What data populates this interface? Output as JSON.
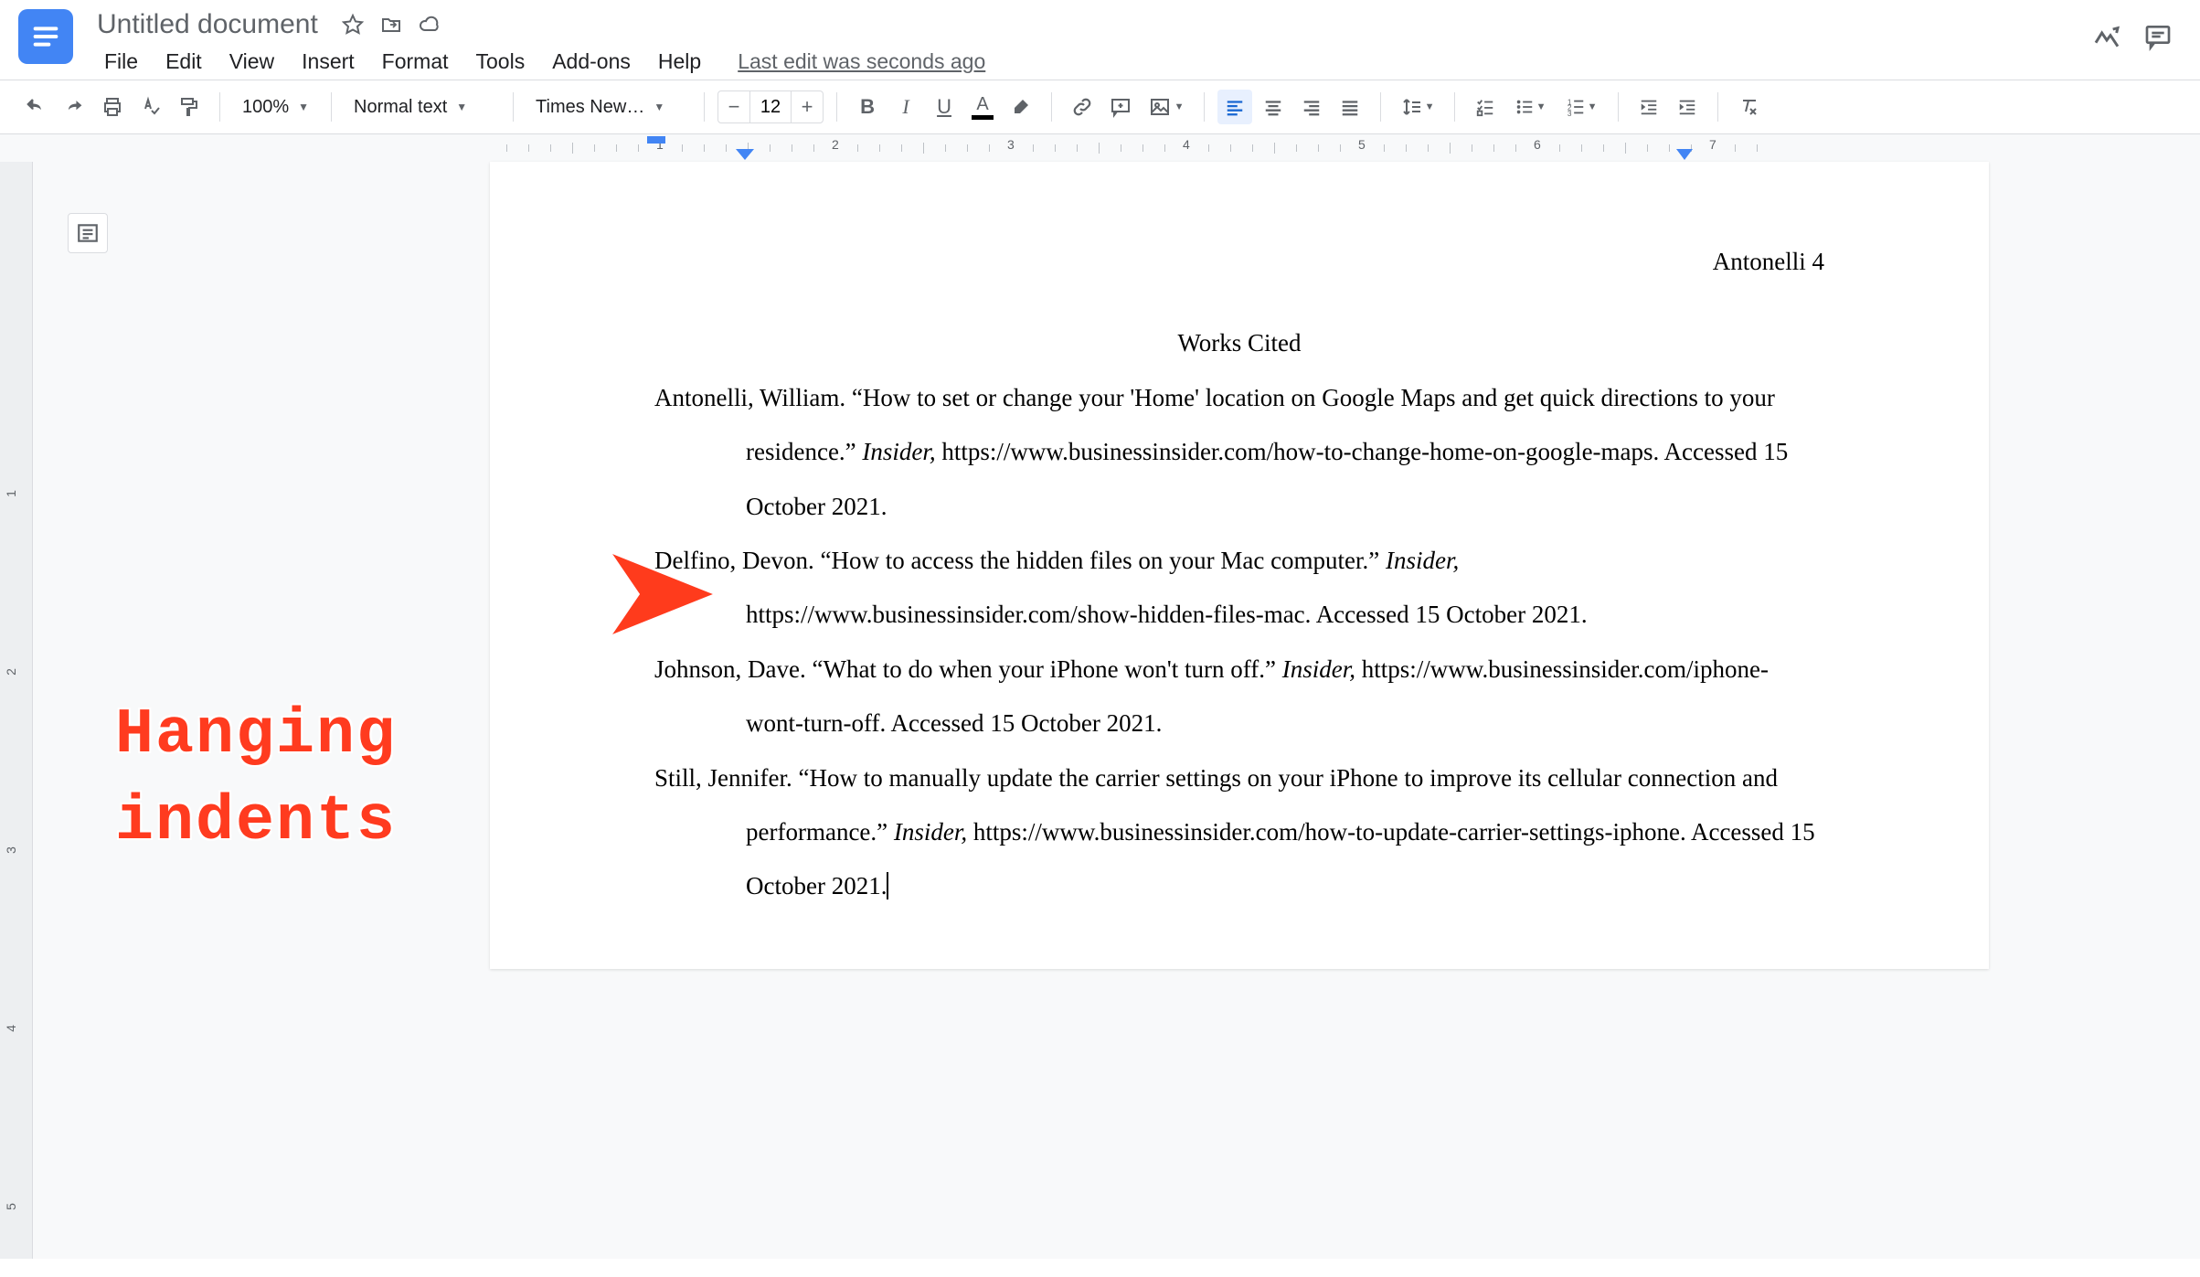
{
  "header": {
    "doc_title": "Untitled document",
    "menu": [
      "File",
      "Edit",
      "View",
      "Insert",
      "Format",
      "Tools",
      "Add-ons",
      "Help"
    ],
    "last_edit": "Last edit was seconds ago"
  },
  "toolbar": {
    "zoom": "100%",
    "style": "Normal text",
    "font": "Times New…",
    "font_size": "12",
    "align": "left"
  },
  "ruler": {
    "marks": [
      "1",
      "2",
      "3",
      "4",
      "5",
      "6",
      "7"
    ],
    "first_line_indent_inches": 0,
    "hanging_indent_inches": 0.5
  },
  "document": {
    "page_header": "Antonelli 4",
    "title": "Works Cited",
    "citations": [
      {
        "author": "Antonelli, William.",
        "article": "“How to set or change your 'Home' location on Google Maps and get quick directions to your residence.”",
        "publication": "Insider,",
        "url": "https://www.businessinsider.com/how-to-change-home-on-google-maps.",
        "accessed": "Accessed 15 October 2021."
      },
      {
        "author": "Delfino, Devon.",
        "article": "“How to access the hidden files on your Mac computer.”",
        "publication": "Insider,",
        "url": "https://www.businessinsider.com/show-hidden-files-mac.",
        "accessed": "Accessed 15 October 2021."
      },
      {
        "author": "Johnson, Dave.",
        "article": "“What to do when your iPhone won't turn off.”",
        "publication": "Insider,",
        "url": "https://www.businessinsider.com/iphone-wont-turn-off.",
        "accessed": "Accessed 15 October 2021."
      },
      {
        "author": "Still, Jennifer.",
        "article": "“How to manually update the carrier settings on your iPhone to improve its cellular connection and performance.”",
        "publication": "Insider,",
        "url": "https://www.businessinsider.com/how-to-update-carrier-settings-iphone.",
        "accessed": "Accessed 15 October 2021."
      }
    ]
  },
  "annotation": {
    "label_line1": "Hanging",
    "label_line2": "indents"
  }
}
